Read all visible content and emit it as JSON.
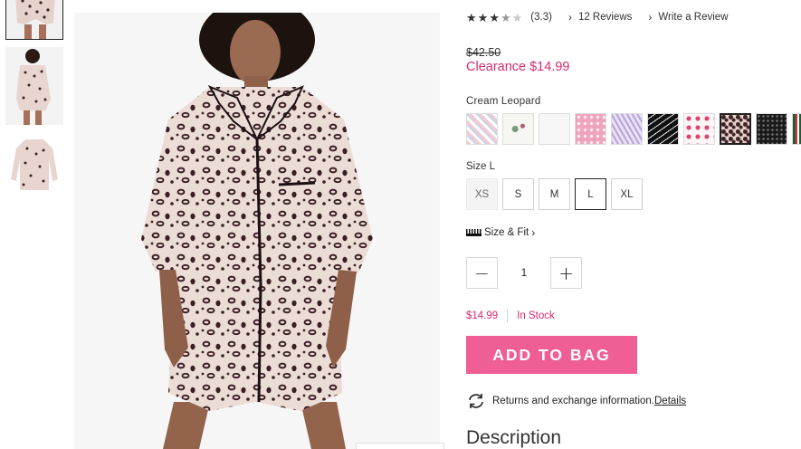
{
  "thumbnails": [
    {
      "icon": "pajama-shorts-thumbnail"
    },
    {
      "icon": "pajama-back-thumbnail"
    },
    {
      "icon": "pajama-flatlay-thumbnail"
    }
  ],
  "main_image": {
    "icon": "leopard-sleepshirt-model-image"
  },
  "rating": {
    "stars_filled": 3,
    "stars_total": 5,
    "value_text": "(3.3)",
    "reviews_link": "12 Reviews",
    "write_review_link": "Write a Review"
  },
  "price": {
    "original": "$42.50",
    "clearance": "Clearance $14.99"
  },
  "color": {
    "selected_name": "Cream Leopard",
    "swatches": [
      {
        "name": "pink-plaid",
        "bg": "repeating-linear-gradient(45deg,#f3c9d2 0 3px,#fff 3px 6px,#c9d6e6 6px 8px)"
      },
      {
        "name": "white-floral",
        "bg": "radial-gradient(circle at 40% 50%,#7a9a7a 0 3px,transparent 4px),radial-gradient(circle at 65% 40%,#b35a6a 0 2px,transparent 3px),#f6f6f2"
      },
      {
        "name": "solid-white",
        "bg": "#f7f7f7"
      },
      {
        "name": "pink-snowflake",
        "bg": "radial-gradient(circle,#fff 1px,transparent 2px) 0 0/7px 7px,#f0a3bd"
      },
      {
        "name": "lavender-print",
        "bg": "repeating-linear-gradient(60deg,#b7a3d9 0 2px,#e8e0f3 2px 5px)"
      },
      {
        "name": "black-script",
        "bg": "repeating-linear-gradient(-35deg,#111 0 5px,#eee 5px 6px)"
      },
      {
        "name": "white-lips",
        "bg": "radial-gradient(circle,#d9446a 0 2px,transparent 3px) 0 0/10px 10px,#fbf5f6"
      },
      {
        "name": "cream-leopard",
        "bg": "radial-gradient(circle at 30% 30%,#3b2226 0 2px,transparent 3px) 0 0/8px 8px,radial-gradient(circle at 70% 70%,#3b2226 0 1.5px,transparent 2.5px) 0 0/8px 8px,#e8d3cc"
      },
      {
        "name": "black-dot",
        "bg": "radial-gradient(circle,#777 0 1px,transparent 1.5px) 0 0/5px 5px,#1a1a1a"
      },
      {
        "name": "plaid-partial",
        "bg": "repeating-linear-gradient(90deg,#1f5c3a 0 3px,#d33 3px 5px,#fff 5px 7px)"
      }
    ],
    "selected_index": 7
  },
  "size": {
    "label": "Size L",
    "options": [
      {
        "label": "XS",
        "state": "disabled"
      },
      {
        "label": "S",
        "state": "available"
      },
      {
        "label": "M",
        "state": "available"
      },
      {
        "label": "L",
        "state": "selected"
      },
      {
        "label": "XL",
        "state": "available"
      }
    ],
    "fit_link": "Size & Fit"
  },
  "quantity": {
    "minus_icon": "minus-icon",
    "value": "1",
    "plus_icon": "plus-icon"
  },
  "stock": {
    "price": "$14.99",
    "status": "In Stock"
  },
  "add_to_bag_label": "ADD TO BAG",
  "returns": {
    "text": "Returns and exchange information.",
    "link": "Details"
  },
  "description_heading": "Description",
  "colors": {
    "accent_pink": "#d9296f",
    "button_pink": "#ef5f96"
  }
}
